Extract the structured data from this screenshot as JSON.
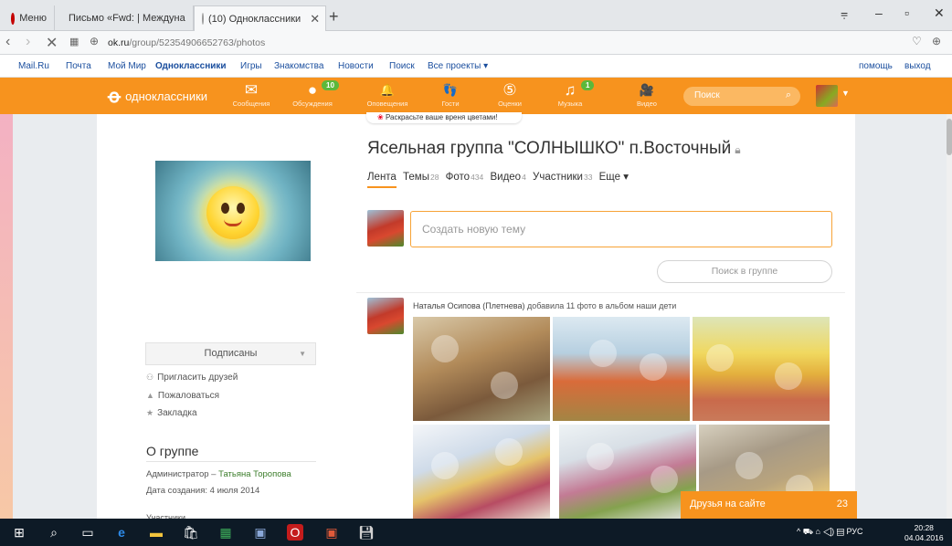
{
  "browser": {
    "tabs": [
      {
        "label": "Меню"
      },
      {
        "label": "Письмо «Fwd: | Междуна"
      },
      {
        "label": "(10) Одноклассники"
      }
    ],
    "url_domain": "ok.ru",
    "url_path": "/group/52354906652763/photos"
  },
  "mailru": {
    "links": [
      "Mail.Ru",
      "Почта",
      "Мой Мир",
      "Одноклассники",
      "Игры",
      "Знакомства",
      "Новости",
      "Поиск",
      "Все проекты ▾"
    ],
    "right_links": [
      "помощь",
      "выход"
    ]
  },
  "ok": {
    "logo": "одноклассники",
    "nav": [
      {
        "icon": "envelope-icon",
        "label": "Сообщения",
        "glyph": "✉"
      },
      {
        "icon": "discussions-icon",
        "label": "Обсуждения",
        "glyph": "●",
        "badge": "10"
      },
      {
        "icon": "bell-icon",
        "label": "Оповещения",
        "glyph": "🔔"
      },
      {
        "icon": "guests-icon",
        "label": "Гости",
        "glyph": "👣"
      },
      {
        "icon": "ratings-icon",
        "label": "Оценки",
        "glyph": "⑤"
      },
      {
        "icon": "music-icon",
        "label": "Музыка",
        "glyph": "♫",
        "badge": "1"
      },
      {
        "icon": "video-icon",
        "label": "Видео",
        "glyph": "🎥"
      }
    ],
    "search_placeholder": "Поиск",
    "promo": "Раскрасьте ваше вреня цветами!"
  },
  "group": {
    "title": "Ясельная  группа \"СОЛНЫШКО\" п.Восточный",
    "tabs": [
      {
        "label": "Лента",
        "count": ""
      },
      {
        "label": "Темы",
        "count": "28"
      },
      {
        "label": "Фото",
        "count": "434"
      },
      {
        "label": "Видео",
        "count": "4"
      },
      {
        "label": "Участники",
        "count": "33"
      },
      {
        "label": "Еще ▾",
        "count": ""
      }
    ],
    "new_topic_placeholder": "Создать новую тему",
    "group_search_placeholder": "Поиск в группе",
    "post": {
      "author": "Наталья Осипова (Плетнева)",
      "action": " добавила 11 фото в альбом наши дети"
    }
  },
  "left": {
    "subscribe": "Подписаны",
    "links": [
      {
        "icon": "invite-icon",
        "label": "Пригласить друзей"
      },
      {
        "icon": "warning-icon",
        "label": "Пожаловаться"
      },
      {
        "icon": "star-icon",
        "label": "Закладка"
      }
    ],
    "about_title": "О группе",
    "admin_label": "Администратор – ",
    "admin_name": "Татьяна Торопова",
    "created": "Дата создания: 4 июля 2014",
    "more": "Участники"
  },
  "friends_online": {
    "label": "Друзья на сайте",
    "count": "23"
  },
  "taskbar": {
    "tray": "^ ⛟ ⌂ ◁) ▤ РУС",
    "time": "20:28",
    "date": "04.04.2016"
  },
  "colors": {
    "ok_orange": "#f7931e",
    "link_blue": "#1a4e9e",
    "admin_green": "#3b7d2a"
  }
}
